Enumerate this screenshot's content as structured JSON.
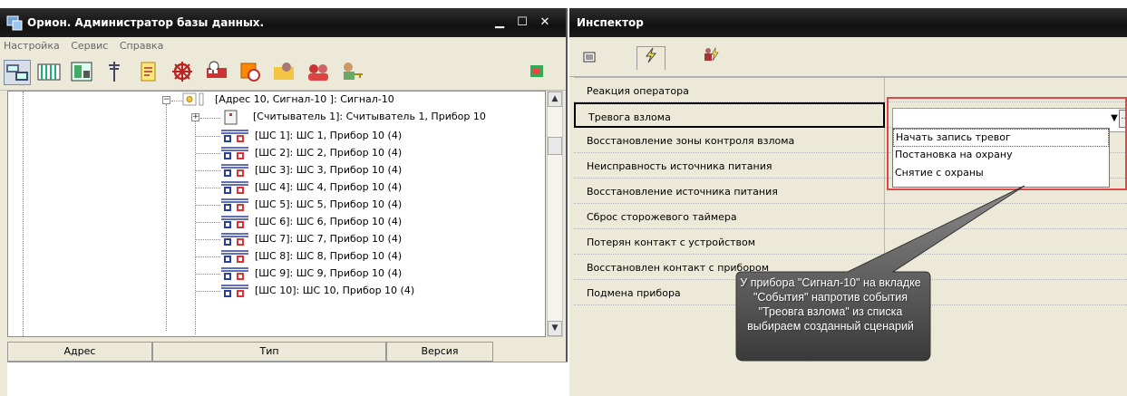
{
  "left_window": {
    "title": "Орион. Администратор базы данных.",
    "menu": [
      "Настройка",
      "Сервис",
      "Справка"
    ],
    "tree": {
      "root": "[Адрес 10, Сигнал-10 ]: Сигнал-10",
      "reader": "[Считыватель 1]: Считыватель 1, Прибор 10",
      "zones": [
        "[ШС 1]: ШС 1, Прибор 10 (4)",
        "[ШС 2]: ШС 2, Прибор 10 (4)",
        "[ШС 3]: ШС 3, Прибор 10 (4)",
        "[ШС 4]: ШС 4, Прибор 10 (4)",
        "[ШС 5]: ШС 5, Прибор 10 (4)",
        "[ШС 6]: ШС 6, Прибор 10 (4)",
        "[ШС 7]: ШС 7, Прибор 10 (4)",
        "[ШС 8]: ШС 8, Прибор 10 (4)",
        "[ШС 9]: ШС 9, Прибор 10 (4)",
        "[ШС 10]: ШС 10, Прибор 10 (4)"
      ]
    },
    "grid_columns": [
      "Адрес",
      "Тип",
      "Версия"
    ]
  },
  "right_window": {
    "title": "Инспектор",
    "properties": [
      "Реакция оператора",
      "Тревога взлома",
      "Восстановление зоны контроля взлома",
      "Неисправность источника питания",
      "Восстановление источника питания",
      "Сброс сторожевого таймера",
      "Потерян контакт с устройством",
      "Восстановлен контакт с прибором",
      "Подмена прибора"
    ],
    "dropdown_options": [
      "Начать запись тревог",
      "Постановка на охрану",
      "Снятие с охраны"
    ],
    "colors": {
      "highlight_frame": "#e04848"
    }
  },
  "callout": {
    "line1": "У прибора \"Сигнал-10\"   на вкладке",
    "line2": "\"События\" напротив события",
    "line3": "\"Треовга взлома\" из списка",
    "line4": "выбираем созданный сценарий"
  }
}
